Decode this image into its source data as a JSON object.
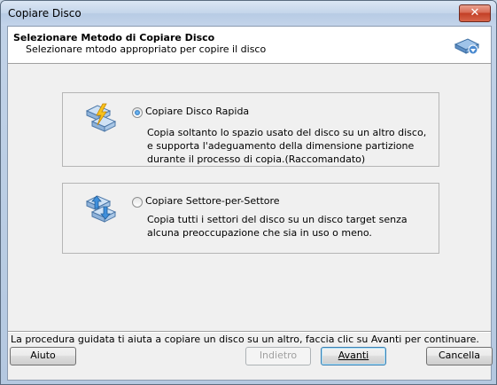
{
  "window": {
    "title": "Copiare Disco",
    "close_glyph": "✕"
  },
  "header": {
    "title": "Selezionare Metodo di Copiare Disco",
    "subtitle": "Selezionare mtodo appropriato per copire il disco",
    "icon": "disk-copy-icon"
  },
  "options": [
    {
      "label": "Copiare Disco Rapida",
      "description": "Copia soltanto lo spazio usato del disco su un altro disco, e supporta l'adeguamento della dimensione partizione durante il processo di copia.(Raccomandato)",
      "selected": true,
      "icon": "quick-copy-disk-icon"
    },
    {
      "label": "Copiare Settore-per-Settore",
      "description": "Copia tutti i settori del disco su un disco target senza alcuna preoccupazione che sia in uso o meno.",
      "selected": false,
      "icon": "sector-copy-disk-icon"
    }
  ],
  "hint": "La procedura guidata ti aiuta a copiare un disco su un altro, faccia clic su Avanti per continuare.",
  "buttons": {
    "help": "Aiuto",
    "back": "Indietro",
    "next": "Avanti",
    "cancel": "Cancella"
  }
}
